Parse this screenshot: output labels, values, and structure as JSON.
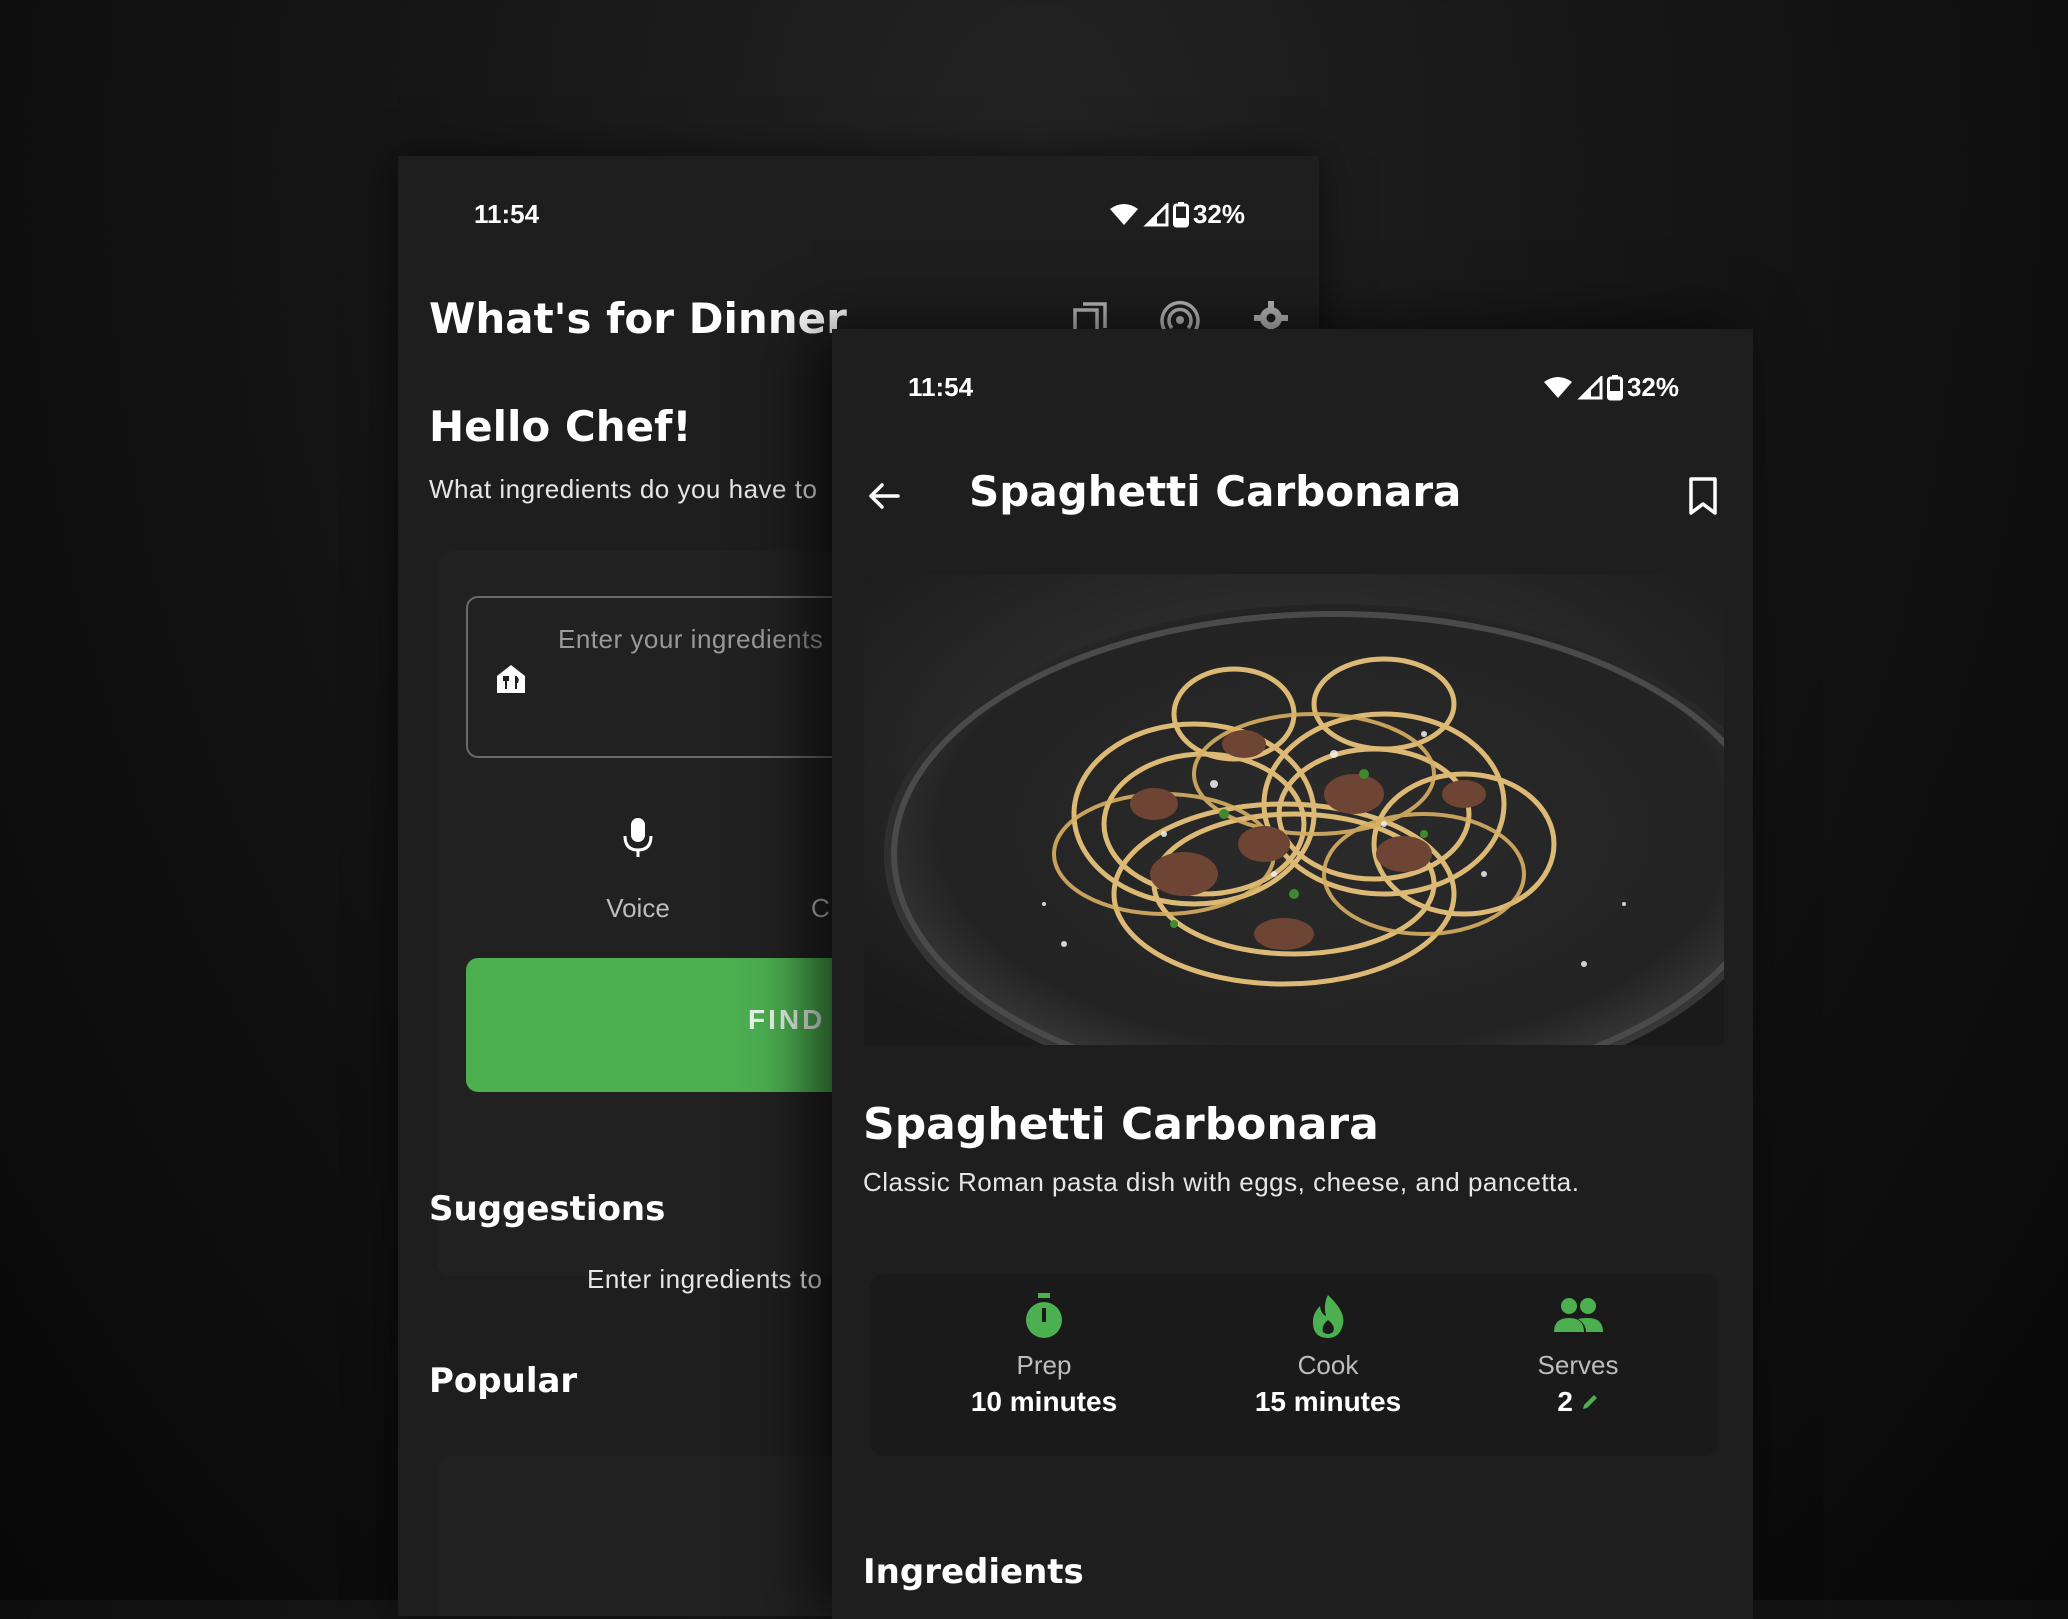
{
  "colors": {
    "accent_green": "#4caf50",
    "surface": "#1e1e1e"
  },
  "home_screen": {
    "status": {
      "time": "11:54",
      "battery": "32%"
    },
    "app_title": "What's for Dinner",
    "toolbar_icons": [
      "copy-icon",
      "nfc-icon",
      "gear-icon"
    ],
    "greeting": "Hello Chef!",
    "question": "What ingredients do you have to",
    "input_placeholder": "Enter your ingredients",
    "voice_label": "Voice",
    "camera_label_partial": "C",
    "find_button_label": "FIND",
    "suggestions_heading": "Suggestions",
    "suggestions_hint": "Enter ingredients to",
    "popular_heading": "Popular"
  },
  "recipe_screen": {
    "status": {
      "time": "11:54",
      "battery": "32%"
    },
    "toolbar_title": "Spaghetti Carbonara",
    "recipe_name": "Spaghetti Carbonara",
    "description": "Classic Roman pasta dish with eggs, cheese, and pancetta.",
    "stats": [
      {
        "label": "Prep",
        "value": "10 minutes",
        "icon": "timer-icon"
      },
      {
        "label": "Cook",
        "value": "15 minutes",
        "icon": "flame-icon"
      },
      {
        "label": "Serves",
        "value": "2",
        "icon": "people-icon"
      }
    ],
    "ingredients_heading": "Ingredients"
  }
}
